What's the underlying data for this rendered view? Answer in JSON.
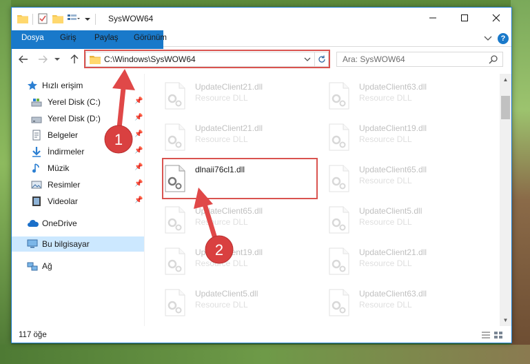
{
  "window": {
    "title": "SysWOW64"
  },
  "ribbon": {
    "tabs": [
      "Dosya",
      "Giriş",
      "Paylaş",
      "Görünüm"
    ]
  },
  "address": {
    "path": "C:\\Windows\\SysWOW64",
    "search_placeholder": "Ara: SysWOW64"
  },
  "nav": {
    "quick_access": "Hızlı erişim",
    "items": [
      {
        "label": "Yerel Disk (C:)",
        "icon": "drive-icon"
      },
      {
        "label": "Yerel Disk (D:)",
        "icon": "drive-icon"
      },
      {
        "label": "Belgeler",
        "icon": "documents-icon"
      },
      {
        "label": "İndirmeler",
        "icon": "downloads-icon"
      },
      {
        "label": "Müzik",
        "icon": "music-icon"
      },
      {
        "label": "Resimler",
        "icon": "pictures-icon"
      },
      {
        "label": "Videolar",
        "icon": "videos-icon"
      }
    ],
    "onedrive": "OneDrive",
    "this_pc": "Bu bilgisayar",
    "network": "Ağ"
  },
  "files": [
    {
      "name": "UpdateClient21.dll",
      "type": "Resource DLL"
    },
    {
      "name": "UpdateClient63.dll",
      "type": "Resource DLL"
    },
    {
      "name": "UpdateClient21.dll",
      "type": "Resource DLL"
    },
    {
      "name": "UpdateClient19.dll",
      "type": "Resource DLL"
    },
    {
      "name": "dlnaii76cl1.dll",
      "type": ""
    },
    {
      "name": "UpdateClient65.dll",
      "type": "Resource DLL"
    },
    {
      "name": "UpdateClient65.dll",
      "type": "Resource DLL"
    },
    {
      "name": "UpdateClient5.dll",
      "type": "Resource DLL"
    },
    {
      "name": "UpdateClient19.dll",
      "type": "Resource DLL"
    },
    {
      "name": "UpdateClient21.dll",
      "type": "Resource DLL"
    },
    {
      "name": "UpdateClient5.dll",
      "type": "Resource DLL"
    },
    {
      "name": "UpdateClient63.dll",
      "type": "Resource DLL"
    }
  ],
  "status": {
    "item_count": "117 öğe"
  },
  "annotations": {
    "step1": "1",
    "step2": "2",
    "color": "#e04848"
  }
}
